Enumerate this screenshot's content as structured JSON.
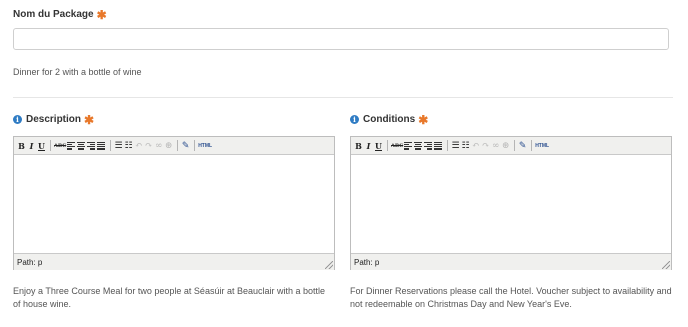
{
  "package_name": {
    "label": "Nom du Package",
    "required_mark": "✱",
    "value": "",
    "hint": "Dinner for 2 with a bottle of wine"
  },
  "description": {
    "label": "Description",
    "required_mark": "✱",
    "info_icon": "info-icon",
    "path_text": "Path: p",
    "hint": "Enjoy a Three Course Meal for two people at Séasúir at Beauclair with a bottle of house wine."
  },
  "conditions": {
    "label": "Conditions",
    "required_mark": "✱",
    "info_icon": "info-icon",
    "path_text": "Path: p",
    "hint": "For Dinner Reservations please call the Hotel. Voucher subject to availability and not redeemable on Christmas Day and New Year's Eve."
  },
  "toolbar": {
    "bold": "B",
    "italic": "I",
    "underline": "U",
    "strike": "ABC",
    "html": "HTML"
  },
  "colors": {
    "required": "#e8782a",
    "info": "#2f7cc4",
    "border": "#cfcfcf"
  }
}
